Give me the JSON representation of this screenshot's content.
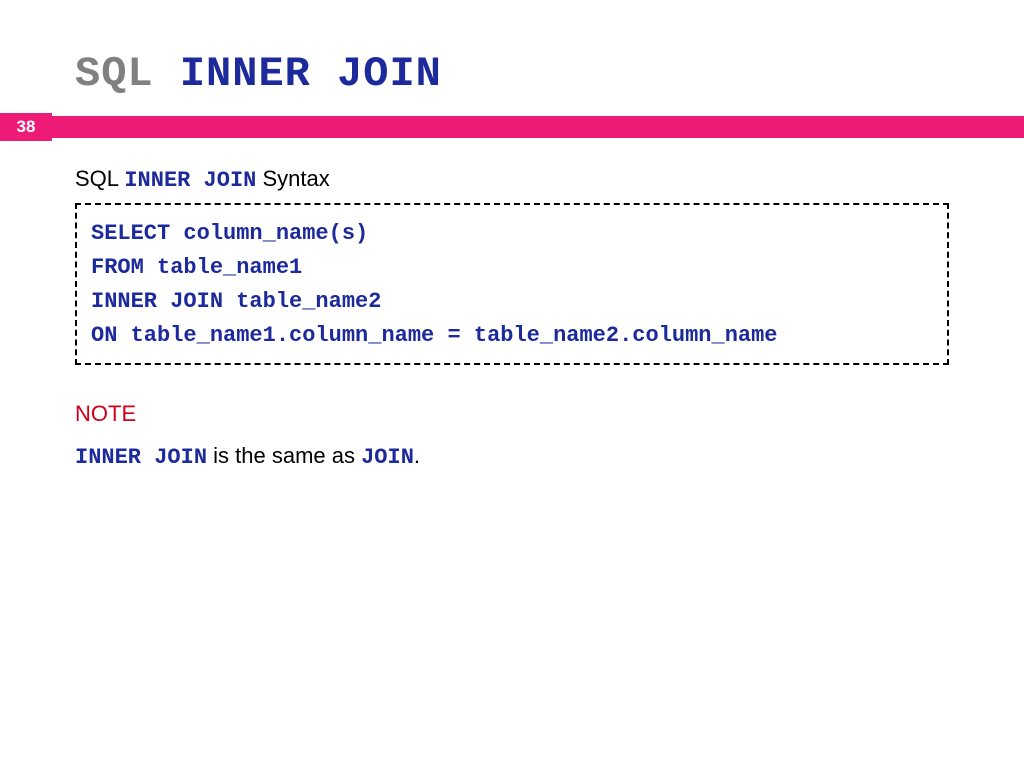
{
  "page_number": "38",
  "title": {
    "prefix": "SQL",
    "main": "INNER JOIN"
  },
  "syntax_header": {
    "prefix": "SQL",
    "keyword": "INNER JOIN",
    "suffix": "Syntax"
  },
  "code": {
    "line1": "SELECT column_name(s)",
    "line2": "FROM table_name1",
    "line3": "INNER JOIN table_name2",
    "line4": "ON table_name1.column_name = table_name2.column_name"
  },
  "note": {
    "heading": "NOTE",
    "kw1": "INNER JOIN",
    "mid": "  is the same as ",
    "kw2": "JOIN",
    "end": "."
  }
}
